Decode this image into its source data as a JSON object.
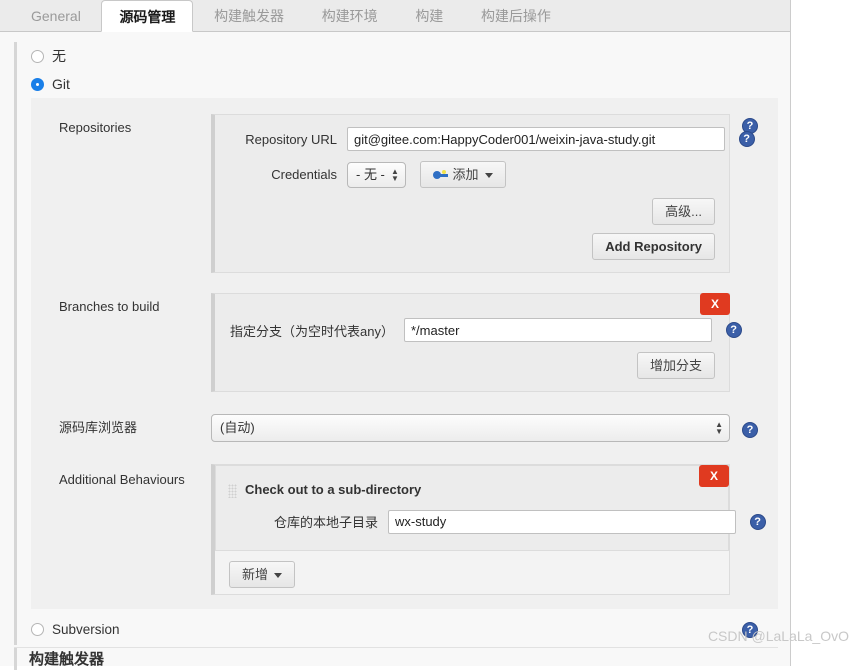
{
  "tabs": [
    {
      "label": "General",
      "active": false
    },
    {
      "label": "源码管理",
      "active": true
    },
    {
      "label": "构建触发器",
      "active": false
    },
    {
      "label": "构建环境",
      "active": false
    },
    {
      "label": "构建",
      "active": false
    },
    {
      "label": "构建后操作",
      "active": false
    }
  ],
  "scm": {
    "none_label": "无",
    "git_label": "Git",
    "subversion_label": "Subversion"
  },
  "repositories": {
    "section_label": "Repositories",
    "url_label": "Repository URL",
    "url_value": "git@gitee.com:HappyCoder001/weixin-java-study.git",
    "credentials_label": "Credentials",
    "credentials_value": "- 无 -",
    "add_credentials_label": "添加",
    "advanced_label": "高级...",
    "add_repository_label": "Add Repository"
  },
  "branches": {
    "section_label": "Branches to build",
    "specifier_label": "指定分支（为空时代表any）",
    "specifier_value": "*/master",
    "add_branch_label": "增加分支",
    "delete_label": "X"
  },
  "browser": {
    "label": "源码库浏览器",
    "value": "(自动)"
  },
  "behaviours": {
    "section_label": "Additional Behaviours",
    "item_title": "Check out to a sub-directory",
    "subdir_label": "仓库的本地子目录",
    "subdir_value": "wx-study",
    "add_label": "新增",
    "delete_label": "X"
  },
  "help_glyph": "?",
  "next_section_label": "构建触发器",
  "watermark": "CSDN @LaLaLa_OvO",
  "colors": {
    "accent_blue": "#1a7fe8",
    "help_blue": "#3b5fa8",
    "delete_red": "#e03a20"
  }
}
